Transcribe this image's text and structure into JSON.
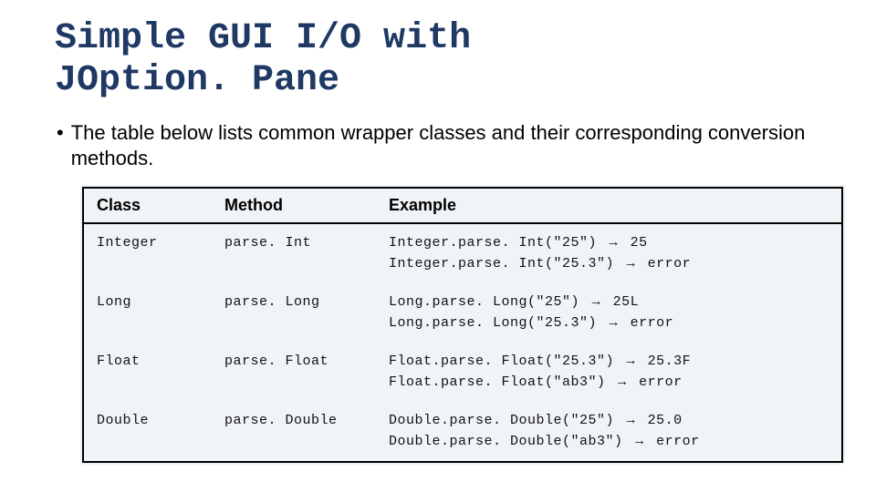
{
  "title_line1": "Simple GUI I/O with",
  "title_line2": "JOption. Pane",
  "bullet": "The table below lists common wrapper classes and their corresponding conversion methods.",
  "headers": {
    "c1": "Class",
    "c2": "Method",
    "c3": "Example"
  },
  "arrow": "→",
  "rows": [
    {
      "class": "Integer",
      "method": "parse. Int",
      "ex": [
        {
          "call": "Integer.parse. Int(\"25\")",
          "result": "25"
        },
        {
          "call": "Integer.parse. Int(\"25.3\")",
          "result": "error"
        }
      ]
    },
    {
      "class": "Long",
      "method": "parse. Long",
      "ex": [
        {
          "call": "Long.parse. Long(\"25\")",
          "result": "25L"
        },
        {
          "call": "Long.parse. Long(\"25.3\")",
          "result": "error"
        }
      ]
    },
    {
      "class": "Float",
      "method": "parse. Float",
      "ex": [
        {
          "call": "Float.parse. Float(\"25.3\")",
          "result": "25.3F"
        },
        {
          "call": "Float.parse. Float(\"ab3\")",
          "result": "error"
        }
      ]
    },
    {
      "class": "Double",
      "method": "parse. Double",
      "ex": [
        {
          "call": "Double.parse. Double(\"25\")",
          "result": "25.0"
        },
        {
          "call": "Double.parse. Double(\"ab3\")",
          "result": "error"
        }
      ]
    }
  ]
}
